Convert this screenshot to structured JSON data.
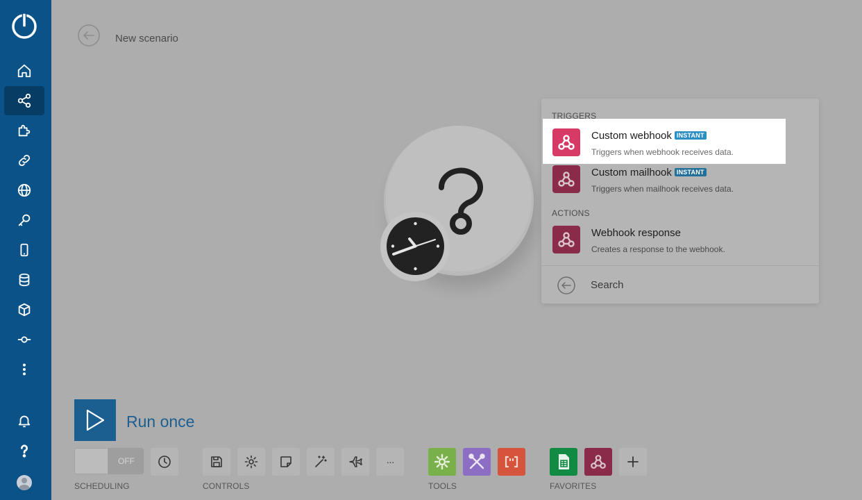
{
  "header": {
    "scenario_title": "New scenario"
  },
  "sidebar": {
    "items": [
      {
        "name": "home",
        "icon": "home-icon"
      },
      {
        "name": "scenarios",
        "icon": "share-icon",
        "active": true
      },
      {
        "name": "templates",
        "icon": "puzzle-icon"
      },
      {
        "name": "connections",
        "icon": "link-icon"
      },
      {
        "name": "webhooks",
        "icon": "globe-icon"
      },
      {
        "name": "keys",
        "icon": "key-icon"
      },
      {
        "name": "devices",
        "icon": "mobile-icon"
      },
      {
        "name": "data-stores",
        "icon": "database-icon"
      },
      {
        "name": "data-structures",
        "icon": "cube-icon"
      },
      {
        "name": "flow",
        "icon": "commit-icon"
      },
      {
        "name": "more",
        "icon": "more-vertical-icon"
      }
    ],
    "bottom": [
      {
        "name": "notifications",
        "icon": "bell-icon"
      },
      {
        "name": "help",
        "icon": "question-icon"
      },
      {
        "name": "profile",
        "icon": "avatar"
      }
    ]
  },
  "dropdown": {
    "triggers_label": "TRIGGERS",
    "actions_label": "ACTIONS",
    "options": [
      {
        "title": "Custom webhook",
        "badge": "INSTANT",
        "desc": "Triggers when webhook receives data."
      },
      {
        "title": "Custom mailhook",
        "badge": "INSTANT",
        "desc": "Triggers when mailhook receives data."
      },
      {
        "title": "Webhook response",
        "desc": "Creates a response to the webhook."
      }
    ],
    "search_label": "Search"
  },
  "run": {
    "label": "Run once"
  },
  "toolbar": {
    "toggle_state": "OFF",
    "scheduling_label": "SCHEDULING",
    "controls_label": "CONTROLS",
    "tools_label": "TOOLS",
    "favorites_label": "FAVORITES",
    "more_label": "···"
  },
  "colors": {
    "sidebar": "#0a5288",
    "sidebar_active": "#073c64",
    "webhook": "#d73a64",
    "badge": "#2b8fc5",
    "run": "#1b5f90",
    "tools_gear": "#79b04a",
    "tools_flow": "#8c6fc4",
    "tools_text": "#d5543b",
    "favorite_sheets": "#118a44"
  }
}
